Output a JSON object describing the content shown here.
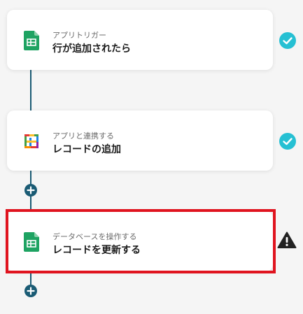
{
  "flow": {
    "steps": [
      {
        "subtitle": "アプリトリガー",
        "title": "行が追加されたら",
        "app_icon": "google-sheets-icon",
        "status": "complete"
      },
      {
        "subtitle": "アプリと連携する",
        "title": "レコードの追加",
        "app_icon": "multicolor-grid-app-icon",
        "status": "complete"
      },
      {
        "subtitle": "データベースを操作する",
        "title": "レコードを更新する",
        "app_icon": "google-sheets-icon",
        "status": "warning",
        "highlighted": true
      }
    ],
    "add_step_icon": "plus-icon",
    "complete_icon": "check-icon",
    "warning_icon": "warning-icon"
  },
  "colors": {
    "background": "#f5f5f5",
    "connector": "#1a5b74",
    "check": "#26c0d3",
    "highlight_border": "#e0141f",
    "sheets_green": "#1ea362",
    "warning": "#222222"
  }
}
